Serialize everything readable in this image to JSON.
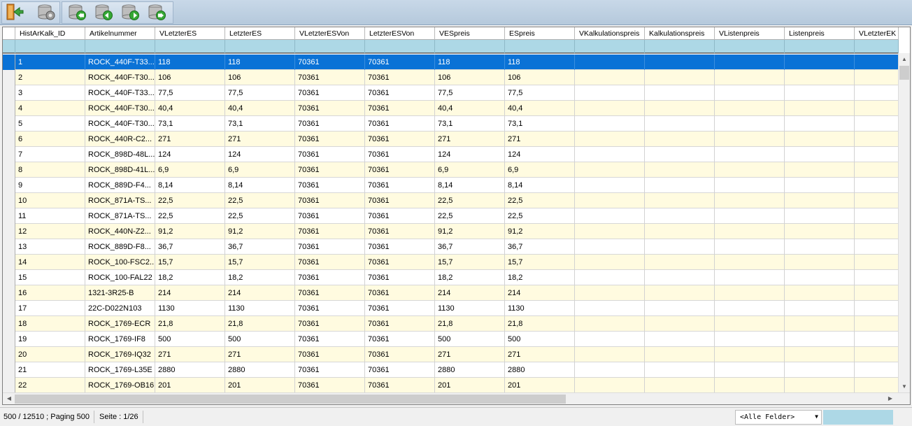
{
  "toolbar": {
    "buttons": [
      {
        "name": "exit-button",
        "icon": "exit-door-icon"
      },
      {
        "name": "database-settings-button",
        "icon": "database-gear-icon"
      },
      {
        "name": "first-page-button",
        "icon": "database-first-icon"
      },
      {
        "name": "previous-page-button",
        "icon": "database-previous-icon"
      },
      {
        "name": "next-page-button",
        "icon": "database-next-icon"
      },
      {
        "name": "last-page-button",
        "icon": "database-last-icon"
      }
    ]
  },
  "grid": {
    "columns": [
      "HistArKalk_ID",
      "Artikelnummer",
      "VLetzterES",
      "LetzterES",
      "VLetzterESVon",
      "LetzterESVon",
      "VESpreis",
      "ESpreis",
      "VKalkulationspreis",
      "Kalkulationspreis",
      "VListenpreis",
      "Listenpreis",
      "VLetzterEK"
    ],
    "rows": [
      [
        "1",
        "ROCK_440F-T33...",
        "118",
        "118",
        "70361",
        "70361",
        "118",
        "118"
      ],
      [
        "2",
        "ROCK_440F-T30...",
        "106",
        "106",
        "70361",
        "70361",
        "106",
        "106"
      ],
      [
        "3",
        "ROCK_440F-T33...",
        "77,5",
        "77,5",
        "70361",
        "70361",
        "77,5",
        "77,5"
      ],
      [
        "4",
        "ROCK_440F-T30...",
        "40,4",
        "40,4",
        "70361",
        "70361",
        "40,4",
        "40,4"
      ],
      [
        "5",
        "ROCK_440F-T30...",
        "73,1",
        "73,1",
        "70361",
        "70361",
        "73,1",
        "73,1"
      ],
      [
        "6",
        "ROCK_440R-C2...",
        "271",
        "271",
        "70361",
        "70361",
        "271",
        "271"
      ],
      [
        "7",
        "ROCK_898D-48L...",
        "124",
        "124",
        "70361",
        "70361",
        "124",
        "124"
      ],
      [
        "8",
        "ROCK_898D-41L...",
        "6,9",
        "6,9",
        "70361",
        "70361",
        "6,9",
        "6,9"
      ],
      [
        "9",
        "ROCK_889D-F4...",
        "8,14",
        "8,14",
        "70361",
        "70361",
        "8,14",
        "8,14"
      ],
      [
        "10",
        "ROCK_871A-TS...",
        "22,5",
        "22,5",
        "70361",
        "70361",
        "22,5",
        "22,5"
      ],
      [
        "11",
        "ROCK_871A-TS...",
        "22,5",
        "22,5",
        "70361",
        "70361",
        "22,5",
        "22,5"
      ],
      [
        "12",
        "ROCK_440N-Z2...",
        "91,2",
        "91,2",
        "70361",
        "70361",
        "91,2",
        "91,2"
      ],
      [
        "13",
        "ROCK_889D-F8...",
        "36,7",
        "36,7",
        "70361",
        "70361",
        "36,7",
        "36,7"
      ],
      [
        "14",
        "ROCK_100-FSC2...",
        "15,7",
        "15,7",
        "70361",
        "70361",
        "15,7",
        "15,7"
      ],
      [
        "15",
        "ROCK_100-FAL22",
        "18,2",
        "18,2",
        "70361",
        "70361",
        "18,2",
        "18,2"
      ],
      [
        "16",
        "1321-3R25-B",
        "214",
        "214",
        "70361",
        "70361",
        "214",
        "214"
      ],
      [
        "17",
        "22C-D022N103",
        "1130",
        "1130",
        "70361",
        "70361",
        "1130",
        "1130"
      ],
      [
        "18",
        "ROCK_1769-ECR",
        "21,8",
        "21,8",
        "70361",
        "70361",
        "21,8",
        "21,8"
      ],
      [
        "19",
        "ROCK_1769-IF8",
        "500",
        "500",
        "70361",
        "70361",
        "500",
        "500"
      ],
      [
        "20",
        "ROCK_1769-IQ32",
        "271",
        "271",
        "70361",
        "70361",
        "271",
        "271"
      ],
      [
        "21",
        "ROCK_1769-L35E",
        "2880",
        "2880",
        "70361",
        "70361",
        "2880",
        "2880"
      ],
      [
        "22",
        "ROCK_1769-OB16",
        "201",
        "201",
        "70361",
        "70361",
        "201",
        "201"
      ]
    ],
    "selected_row": 1
  },
  "status": {
    "records": "500 / 12510 ; Paging 500",
    "page": "Seite : 1/26",
    "field_select": "<Alle Felder>"
  },
  "colors": {
    "selection": "#0a72d6",
    "filter_row": "#add8e6",
    "alt_row": "#fffbe0"
  }
}
